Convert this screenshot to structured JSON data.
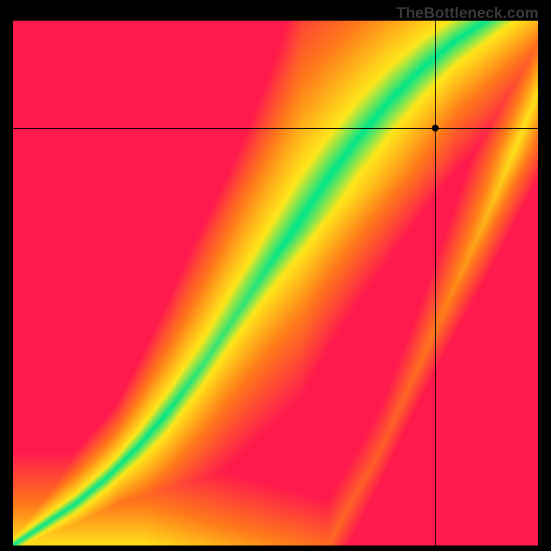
{
  "watermark": "TheBottleneck.com",
  "colors": {
    "red": "#ff1a4d",
    "orange": "#ff7a1a",
    "yellow": "#ffe61a",
    "green": "#00e58a"
  },
  "chart_data": {
    "type": "heatmap",
    "title": "",
    "xlabel": "",
    "ylabel": "",
    "xlim": [
      0,
      100
    ],
    "ylim": [
      0,
      100
    ],
    "note": "Value axes are normalized 0–100 because no tick labels are rendered in the screenshot.",
    "crosshair": {
      "x": 80.5,
      "y": 79.5
    },
    "ridge_points": [
      {
        "x": 0,
        "y": 0
      },
      {
        "x": 6,
        "y": 4
      },
      {
        "x": 12,
        "y": 8
      },
      {
        "x": 18,
        "y": 13
      },
      {
        "x": 24,
        "y": 19
      },
      {
        "x": 30,
        "y": 26
      },
      {
        "x": 36,
        "y": 34
      },
      {
        "x": 42,
        "y": 43
      },
      {
        "x": 48,
        "y": 52
      },
      {
        "x": 54,
        "y": 61
      },
      {
        "x": 60,
        "y": 70
      },
      {
        "x": 66,
        "y": 78
      },
      {
        "x": 72,
        "y": 85
      },
      {
        "x": 78,
        "y": 91
      },
      {
        "x": 84,
        "y": 96
      },
      {
        "x": 90,
        "y": 100
      }
    ],
    "ridge_width_profile": [
      {
        "x": 0,
        "half_width": 1.0
      },
      {
        "x": 20,
        "half_width": 2.0
      },
      {
        "x": 40,
        "half_width": 5.0
      },
      {
        "x": 55,
        "half_width": 7.5
      },
      {
        "x": 70,
        "half_width": 6.0
      },
      {
        "x": 85,
        "half_width": 4.0
      },
      {
        "x": 100,
        "half_width": 3.0
      }
    ],
    "color_scale": [
      {
        "distance_norm": 0.0,
        "color": "green"
      },
      {
        "distance_norm": 0.18,
        "color": "yellow"
      },
      {
        "distance_norm": 0.55,
        "color": "orange"
      },
      {
        "distance_norm": 1.0,
        "color": "red"
      }
    ],
    "secondary_ridge_points": [
      {
        "x": 60,
        "y": 0
      },
      {
        "x": 70,
        "y": 18
      },
      {
        "x": 80,
        "y": 40
      },
      {
        "x": 90,
        "y": 62
      },
      {
        "x": 100,
        "y": 86
      }
    ]
  }
}
